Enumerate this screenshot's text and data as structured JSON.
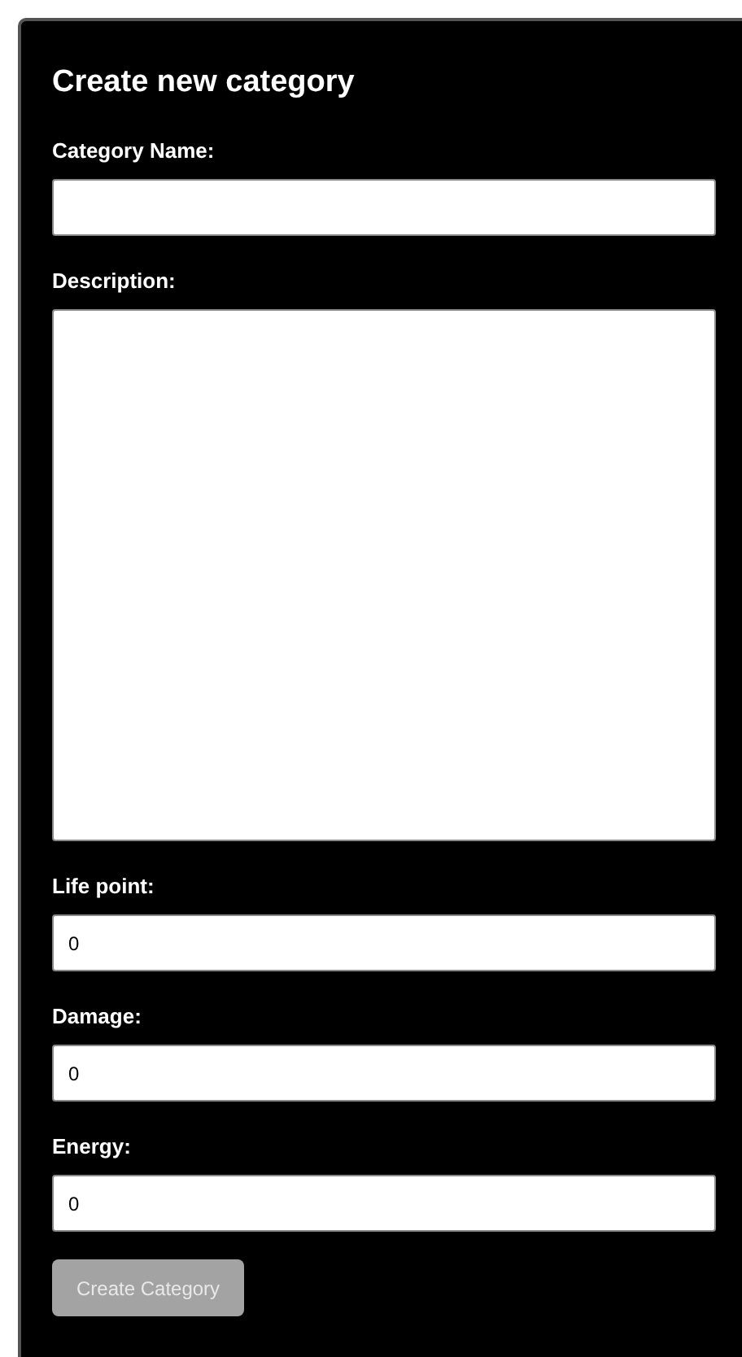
{
  "title": "Create new category",
  "fields": [
    {
      "label": "Category Name:",
      "kind": "text"
    },
    {
      "label": "Description:",
      "kind": "textarea"
    },
    {
      "label": "Life point:",
      "kind": "number",
      "value": "0"
    },
    {
      "label": "Damage:",
      "kind": "number",
      "value": "0"
    },
    {
      "label": "Energy:",
      "kind": "number",
      "value": "0"
    }
  ],
  "submit": {
    "label": "Create Category",
    "disabled": true
  }
}
